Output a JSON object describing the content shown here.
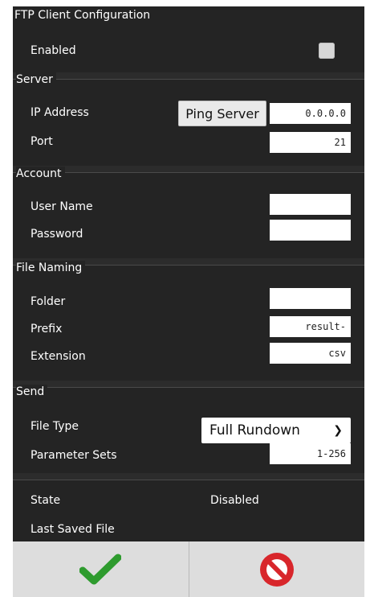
{
  "title": "FTP Client Configuration",
  "enabled": {
    "label": "Enabled",
    "checked": false
  },
  "server": {
    "title": "Server",
    "ip_label": "IP Address",
    "ping_label": "Ping Server",
    "ip_value": "0.0.0.0",
    "port_label": "Port",
    "port_value": "21"
  },
  "account": {
    "title": "Account",
    "user_label": "User Name",
    "user_value": "",
    "password_label": "Password",
    "password_value": ""
  },
  "file_naming": {
    "title": "File Naming",
    "folder_label": "Folder",
    "folder_value": "",
    "prefix_label": "Prefix",
    "prefix_value": "result-",
    "extension_label": "Extension",
    "extension_value": "csv"
  },
  "send": {
    "title": "Send",
    "file_type_label": "File Type",
    "file_type_value": "Full Rundown",
    "param_sets_label": "Parameter Sets",
    "param_sets_value": "1-256"
  },
  "status": {
    "state_label": "State",
    "state_value": "Disabled",
    "last_saved_label": "Last Saved File",
    "last_saved_value": ""
  },
  "footer": {
    "confirm_icon": "checkmark-icon",
    "cancel_icon": "no-entry-icon",
    "confirm_color": "#2e9b2e",
    "cancel_color": "#d8262b"
  }
}
